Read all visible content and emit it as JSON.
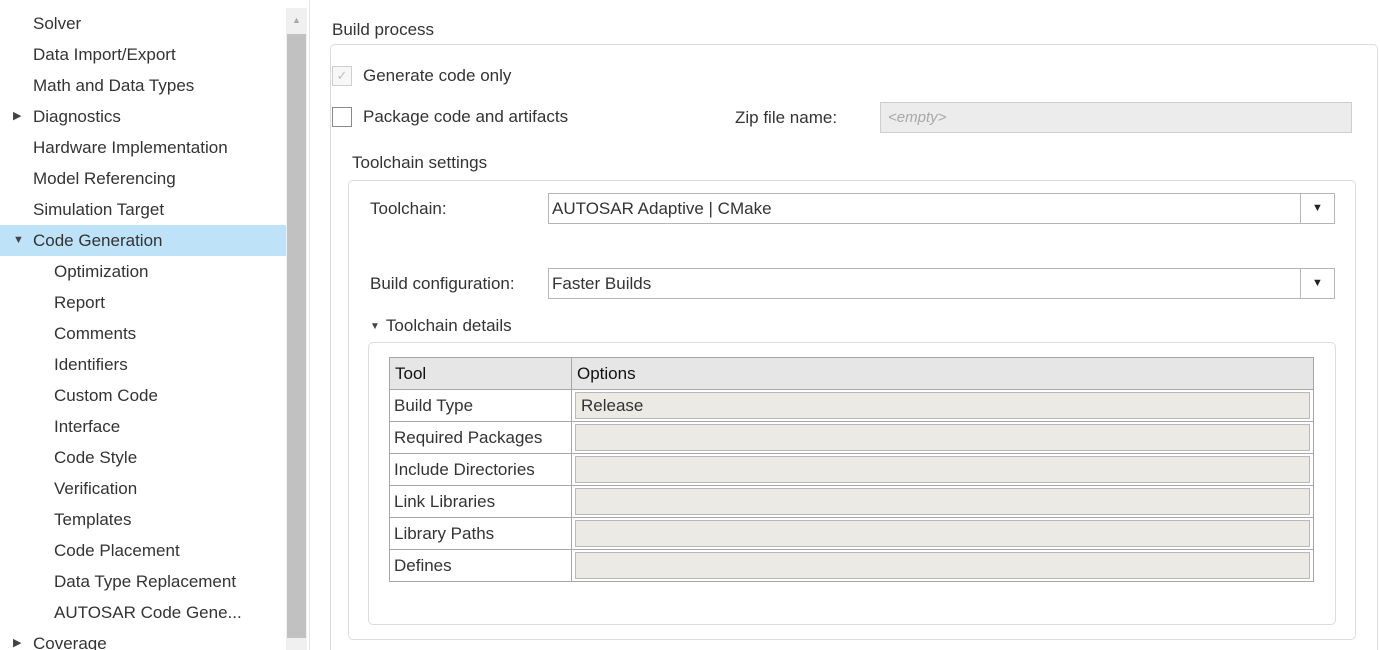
{
  "sidebar": {
    "items": [
      {
        "label": "Solver",
        "level": 0,
        "expander": "",
        "selected": false
      },
      {
        "label": "Data Import/Export",
        "level": 0,
        "expander": "",
        "selected": false
      },
      {
        "label": "Math and Data Types",
        "level": 0,
        "expander": "",
        "selected": false
      },
      {
        "label": "Diagnostics",
        "level": 0,
        "expander": "collapsed",
        "selected": false
      },
      {
        "label": "Hardware Implementation",
        "level": 0,
        "expander": "",
        "selected": false
      },
      {
        "label": "Model Referencing",
        "level": 0,
        "expander": "",
        "selected": false
      },
      {
        "label": "Simulation Target",
        "level": 0,
        "expander": "",
        "selected": false
      },
      {
        "label": "Code Generation",
        "level": 0,
        "expander": "expanded",
        "selected": true
      },
      {
        "label": "Optimization",
        "level": 1,
        "expander": "",
        "selected": false
      },
      {
        "label": "Report",
        "level": 1,
        "expander": "",
        "selected": false
      },
      {
        "label": "Comments",
        "level": 1,
        "expander": "",
        "selected": false
      },
      {
        "label": "Identifiers",
        "level": 1,
        "expander": "",
        "selected": false
      },
      {
        "label": "Custom Code",
        "level": 1,
        "expander": "",
        "selected": false
      },
      {
        "label": "Interface",
        "level": 1,
        "expander": "",
        "selected": false
      },
      {
        "label": "Code Style",
        "level": 1,
        "expander": "",
        "selected": false
      },
      {
        "label": "Verification",
        "level": 1,
        "expander": "",
        "selected": false
      },
      {
        "label": "Templates",
        "level": 1,
        "expander": "",
        "selected": false
      },
      {
        "label": "Code Placement",
        "level": 1,
        "expander": "",
        "selected": false
      },
      {
        "label": "Data Type Replacement",
        "level": 1,
        "expander": "",
        "selected": false
      },
      {
        "label": "AUTOSAR Code Gene...",
        "level": 1,
        "expander": "",
        "selected": false
      },
      {
        "label": "Coverage",
        "level": 0,
        "expander": "collapsed",
        "selected": false
      }
    ],
    "selection_color": "#bee2f8"
  },
  "build_process": {
    "title": "Build process",
    "generate_code_only": {
      "label": "Generate code only",
      "checked": true,
      "enabled": false
    },
    "package_code": {
      "label": "Package code and artifacts",
      "checked": false,
      "enabled": true
    },
    "zip_file": {
      "label": "Zip file name:",
      "placeholder": "<empty>"
    }
  },
  "toolchain_settings": {
    "title": "Toolchain settings",
    "toolchain": {
      "label": "Toolchain:",
      "value": "AUTOSAR Adaptive | CMake"
    },
    "build_configuration": {
      "label": "Build configuration:",
      "value": "Faster Builds"
    },
    "details": {
      "toggle_label": "Toolchain details",
      "expanded": true,
      "table": {
        "headers": [
          "Tool",
          "Options"
        ],
        "rows": [
          {
            "tool": "Build Type",
            "options": "Release"
          },
          {
            "tool": "Required Packages",
            "options": ""
          },
          {
            "tool": "Include Directories",
            "options": ""
          },
          {
            "tool": "Link Libraries",
            "options": ""
          },
          {
            "tool": "Library Paths",
            "options": ""
          },
          {
            "tool": "Defines",
            "options": ""
          }
        ]
      }
    }
  },
  "icons": {
    "collapsed_arrow": "▶",
    "expanded_arrow": "▼",
    "dropdown_arrow": "▼",
    "checkmark": "✓",
    "scroll_up": "▲"
  }
}
